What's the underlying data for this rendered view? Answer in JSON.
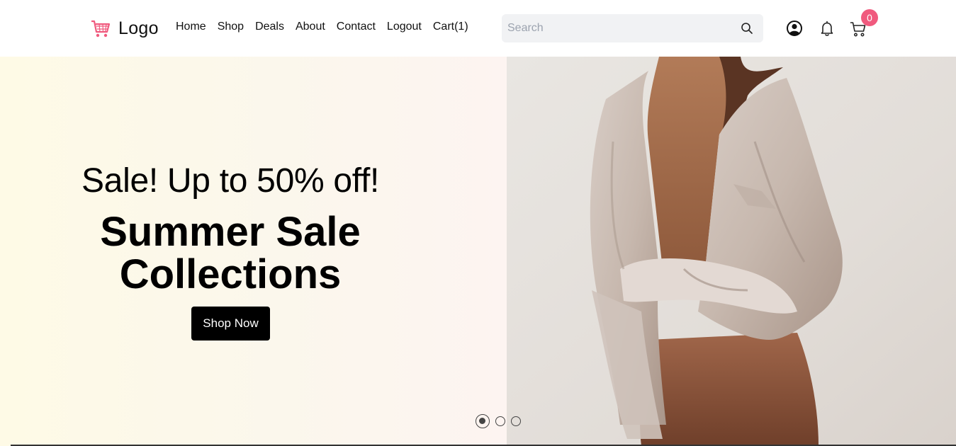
{
  "header": {
    "logo_text": "Logo",
    "nav": [
      "Home",
      "Shop",
      "Deals",
      "About",
      "Contact",
      "Logout",
      "Cart(1)"
    ],
    "search_placeholder": "Search",
    "cart_badge": "0"
  },
  "hero": {
    "subtitle": "Sale! Up to 50% off!",
    "title_line1": "Summer Sale",
    "title_line2": "Collections",
    "cta_label": "Shop Now",
    "slide_count": 3,
    "active_slide": 1
  },
  "colors": {
    "accent": "#f05a7e",
    "button_bg": "#000000",
    "search_bg": "#f1f2f4"
  },
  "icons": [
    "cart-logo-icon",
    "search-icon",
    "user-icon",
    "bell-icon",
    "cart-icon"
  ]
}
